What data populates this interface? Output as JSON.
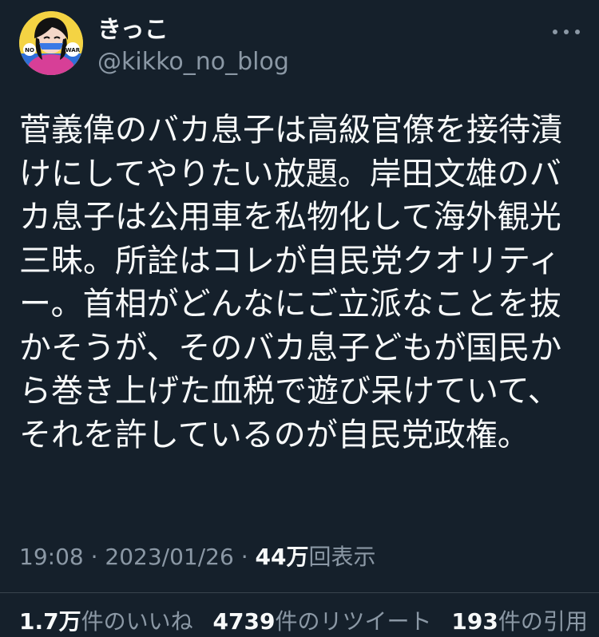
{
  "user": {
    "display_name": "きっこ",
    "handle": "@kikko_no_blog",
    "avatar_badge_left": "NO",
    "avatar_badge_right": "WAR"
  },
  "tweet": {
    "text": "菅義偉のバカ息子は高級官僚を接待漬けにしてやりたい放題。岸田文雄のバカ息子は公用車を私物化して海外観光三昧。所詮はコレが自民党クオリティー。首相がどんなにご立派なことを抜かそうが、そのバカ息子どもが国民から巻き上げた血税で遊び呆けていて、それを許しているのが自民党政権。"
  },
  "meta": {
    "time": "19:08",
    "sep1": " · ",
    "date": "2023/01/26",
    "sep2": " · ",
    "views_count": "44万",
    "views_label": "回表示"
  },
  "stats": {
    "likes_count": "1.7万",
    "likes_label": "件のいいね",
    "retweets_count": "4739",
    "retweets_label": "件のリツイート",
    "quotes_count": "193",
    "quotes_label": "件の引用"
  },
  "icons": {
    "more": "more-horizontal-icon"
  }
}
